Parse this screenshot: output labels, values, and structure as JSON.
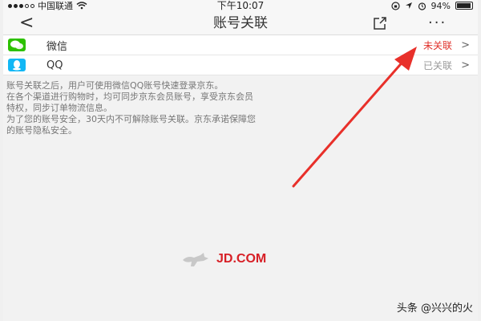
{
  "status_bar": {
    "carrier": "中国联通",
    "time": "下午10:07",
    "battery_percent": "94%",
    "battery_level": 0.94
  },
  "nav": {
    "back": "<",
    "title": "账号关联",
    "more": "···"
  },
  "accounts": [
    {
      "name": "微信",
      "status": "未关联",
      "status_color": "#e0312b",
      "chevron": ">"
    },
    {
      "name": "QQ",
      "status": "已关联",
      "status_color": "#999999",
      "chevron": ">"
    }
  ],
  "info_lines": [
    "账号关联之后，用户可使用微信QQ账号快速登录京东。",
    "在各个渠道进行购物时，均可同步京东会员账号，享受京东会员",
    "特权，同步订单物流信息。",
    "为了您的账号安全，30天内不可解除账号关联。京东承诺保障您",
    "的账号隐私安全。"
  ],
  "brand": {
    "text": "JD.COM",
    "color": "#d71f26"
  },
  "watermark": "头条 @兴兴的火",
  "colors": {
    "wechat_green": "#2dc100",
    "qq_blue": "#12b7f5",
    "annotation_red": "#e8302a"
  }
}
